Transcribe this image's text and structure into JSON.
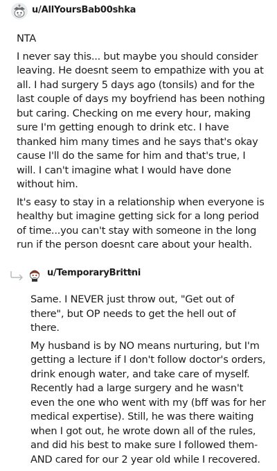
{
  "comments": [
    {
      "username": "u/AllYoursBab00shka",
      "separator": "•",
      "avatar_icon": "snoo-avatar-icon",
      "paragraphs": [
        "NTA",
        "I never say this... but maybe you should consider leaving. He doesnt seem to empathize with you at all. I had surgery 5 days ago (tonsils) and for the last couple of days my boyfriend has been nothing but caring. Checking on me every hour, making sure I'm getting enough to drink etc. I have thanked him many times and he says that's okay cause I'll do the same for him and that's true, I will. I can't imagine what I would have done without him.",
        "It's easy to stay in a relationship when everyone is healthy but imagine getting sick for a long period of time...you can't stay with someone in the long run if the person doesnt care about your health."
      ]
    },
    {
      "username": "u/TemporaryBrittni",
      "separator": "•",
      "avatar_icon": "snoo-avatar-icon",
      "reply_icon": "reply-arrow-icon",
      "paragraphs": [
        "Same. I NEVER just throw out, \"Get out of there\", but OP needs to get the hell out of there.",
        "My husband is by NO means nurturing, but I'm getting a lecture if I don't follow doctor's orders, drink enough water, and take care of myself. Recently had a large surgery and he wasn't even the one who went with my (bff was for her medical expertise). Still, he was there waiting when I got out, he wrote down all of the rules, and did his best to make sure I followed them- AND cared for our 2 year old while I recovered."
      ]
    }
  ]
}
